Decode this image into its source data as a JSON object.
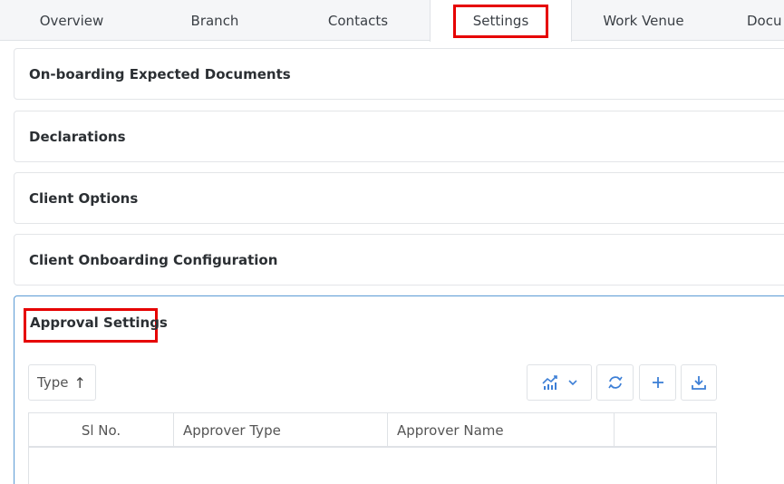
{
  "tabs": [
    {
      "label": "Overview",
      "active": false
    },
    {
      "label": "Branch",
      "active": false
    },
    {
      "label": "Contacts",
      "active": false
    },
    {
      "label": "Settings",
      "active": true
    },
    {
      "label": "Work Venue",
      "active": false
    },
    {
      "label": "Docu",
      "active": false
    }
  ],
  "sections": [
    {
      "title": "On-boarding Expected Documents"
    },
    {
      "title": "Declarations"
    },
    {
      "title": "Client Options"
    },
    {
      "title": "Client Onboarding Configuration"
    }
  ],
  "approval": {
    "title": "Approval Settings",
    "sort_label": "Type",
    "sort_arrow": "↑",
    "toolbar": {
      "chart_icon": "chart-icon",
      "refresh_icon": "refresh-icon",
      "add_icon": "plus-icon",
      "download_icon": "download-icon"
    },
    "columns": [
      "Sl No.",
      "Approver Type",
      "Approver Name",
      ""
    ]
  },
  "colors": {
    "accent": "#3d7fd6",
    "highlight": "#e60000",
    "panel_border_active": "#5b9bd5"
  }
}
